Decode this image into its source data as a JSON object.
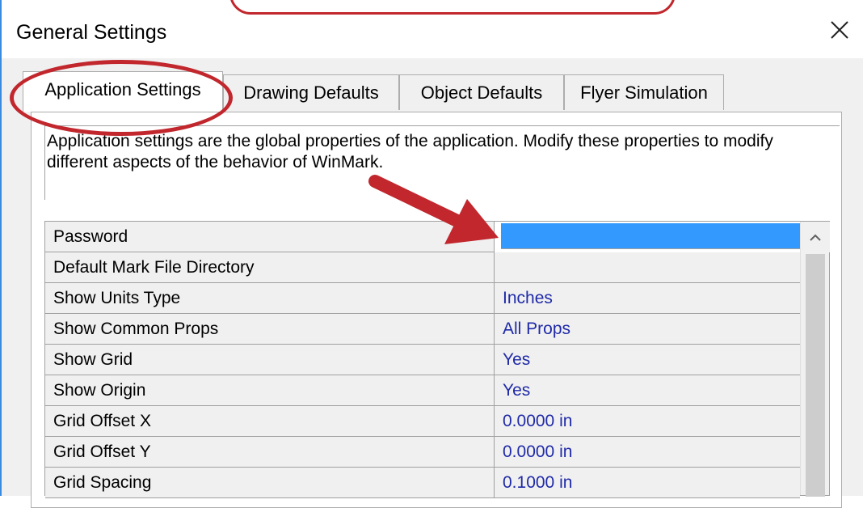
{
  "window": {
    "title": "General Settings",
    "close_icon": "close-icon"
  },
  "tabs": [
    {
      "label": "Application Settings",
      "active": true
    },
    {
      "label": "Drawing Defaults",
      "active": false
    },
    {
      "label": "Object Defaults",
      "active": false
    },
    {
      "label": "Flyer Simulation",
      "active": false
    }
  ],
  "panel": {
    "description": "Application settings are the global properties of the application. Modify these properties to modify different aspects of the behavior of WinMark."
  },
  "properties": [
    {
      "name": "Password",
      "value": ""
    },
    {
      "name": "Default Mark File Directory",
      "value": ""
    },
    {
      "name": "Show Units Type",
      "value": "Inches"
    },
    {
      "name": "Show Common Props",
      "value": "All Props"
    },
    {
      "name": "Show Grid",
      "value": "Yes"
    },
    {
      "name": "Show Origin",
      "value": "Yes"
    },
    {
      "name": "Grid Offset X",
      "value": "0.0000 in"
    },
    {
      "name": "Grid Offset Y",
      "value": "0.0000 in"
    },
    {
      "name": "Grid Spacing",
      "value": "0.1000 in"
    }
  ],
  "colors": {
    "annotation_red": "#c1272d",
    "selection_blue": "#3399ff",
    "value_text": "#1f2aa8"
  }
}
